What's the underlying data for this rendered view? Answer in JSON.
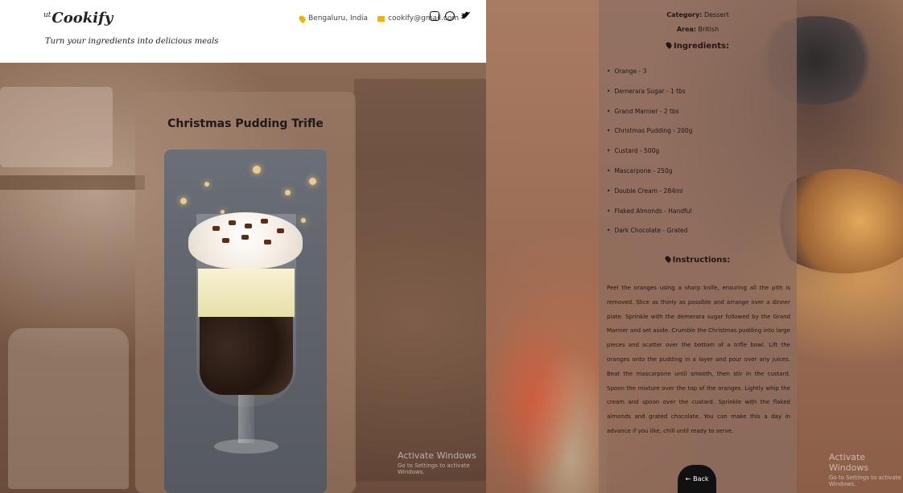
{
  "header": {
    "logo_sup": "ut",
    "logo": "Cookify",
    "tagline": "Turn your ingredients into delicious meals",
    "location": "Bengaluru, India",
    "email": "cookify@gmail.com",
    "socials": [
      "instagram-icon",
      "whatsapp-icon",
      "twitter-icon"
    ]
  },
  "recipe": {
    "title": "Christmas Pudding Trifle",
    "category_label": "Category:",
    "category": "Dessert",
    "area_label": "Area:",
    "area": "British",
    "ingredients_title": "Ingredients:",
    "ingredients": [
      "Orange - 3",
      "Demerara Sugar - 1 tbs",
      "Grand Marnier - 2 tbs",
      "Christmas Pudding - 200g",
      "Custard - 500g",
      "Mascarpone - 250g",
      "Double Cream - 284ml",
      "Flaked Almonds - Handful",
      "Dark Chocolate - Grated"
    ],
    "instructions_title": "Instructions:",
    "instructions": "Peel the oranges using a sharp knife, ensuring all the pith is removed. Slice as thinly as possible and arrange over a dinner plate. Sprinkle with the demerara sugar followed by the Grand Marnier and set aside. Crumble the Christmas pudding into large pieces and scatter over the bottom of a trifle bowl. Lift the oranges onto the pudding in a layer and pour over any juices. Beat the mascarpone until smooth, then stir in the custard. Spoon the mixture over the top of the oranges. Lightly whip the cream and spoon over the custard. Sprinkle with the flaked almonds and grated chocolate. You can make this a day in advance if you like, chill until ready to serve.",
    "back_label": "Back"
  },
  "watermark": {
    "title": "Activate Windows",
    "subtitle": "Go to Settings to activate Windows."
  },
  "colors": {
    "accent": "#f0b400",
    "button": "#111111"
  }
}
